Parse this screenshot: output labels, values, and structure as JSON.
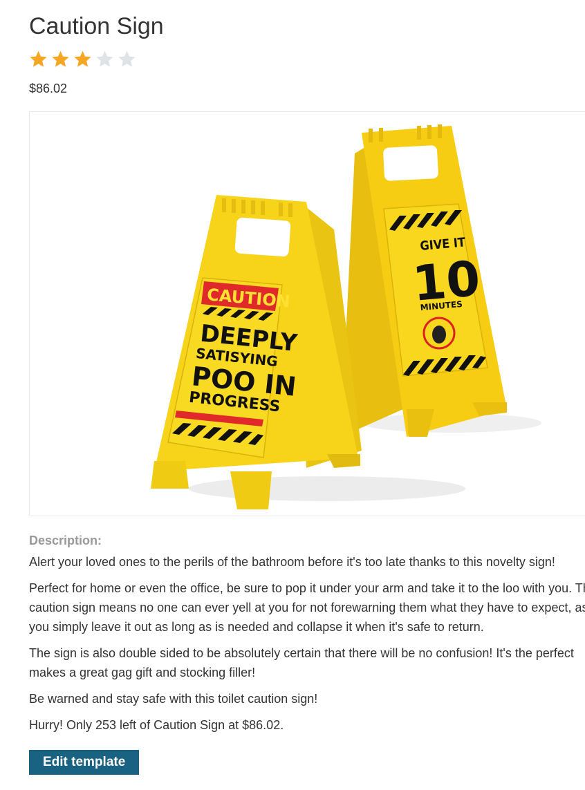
{
  "product": {
    "title": "Caution Sign",
    "rating": 3,
    "rating_max": 5,
    "price": "$86.02",
    "image": {
      "front_sign_lines": [
        "CAUTION",
        "DEEPLY",
        "SATISYING",
        "POO IN",
        "PROGRESS"
      ],
      "back_sign_lines": [
        "GIVE IT",
        "10",
        "MINUTES"
      ]
    }
  },
  "description": {
    "label": "Description:",
    "paragraphs": [
      "Alert your loved ones to the perils of the bathroom before it's too late thanks to this novelty sign!",
      "Perfect for home or even the office, be sure to pop it under your arm and take it to the loo with you. This",
      "The sign is also double sided to be absolutely certain that there will be no confusion! It's the perfect",
      "Be warned and stay safe with this toilet caution sign!",
      "Hurry! Only 253 left of Caution Sign at $86.02."
    ],
    "paragraph2_lines": [
      "Perfect for home or even the office, be sure to pop it under your arm and take it to the loo with you. This",
      "caution sign means no one can ever yell at you for not forewarning them what they have to expect, as",
      "you simply leave it out as long as is needed and collapse it when it's safe to return."
    ],
    "paragraph3_lines": [
      "The sign is also double sided to be absolutely certain that there will be no confusion! It's the perfect",
      "makes a great gag gift and stocking filler!"
    ]
  },
  "actions": {
    "edit_label": "Edit template"
  },
  "colors": {
    "star_filled": "#f5a623",
    "star_empty": "#dde3e6",
    "button_bg": "#1a6282",
    "label_gray": "#999999",
    "sign_yellow": "#f7d317"
  },
  "icons": {
    "star": "star-icon"
  }
}
